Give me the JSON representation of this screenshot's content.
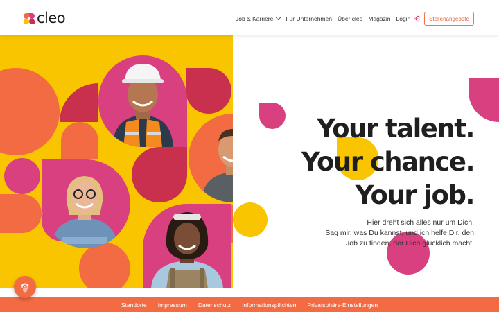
{
  "header": {
    "logo_text": "cleo",
    "nav": [
      {
        "label": "Job & Karriere"
      },
      {
        "label": "Für Unternehmen"
      },
      {
        "label": "Über cleo"
      },
      {
        "label": "Magazin"
      },
      {
        "label": "Login"
      }
    ],
    "cta_label": "Stellenangebote"
  },
  "hero": {
    "headline": [
      "Your talent.",
      "Your chance.",
      "Your job."
    ],
    "subtext": [
      "Hier dreht sich alles nur um Dich.",
      "Sag mir, was Du kannst, und ich helfe Dir, den",
      "Job zu finden, der Dich glücklich macht."
    ]
  },
  "footer": {
    "links": [
      "Standorte",
      "Impressum",
      "Datenschutz",
      "Informationspflichten",
      "Privatsphäre-Einstellungen"
    ]
  },
  "icons": {
    "dropdown": "chevron-down-icon",
    "login": "login-arrow-icon",
    "privacy": "fingerprint-icon"
  },
  "colors": {
    "yellow": "#f8c500",
    "orange": "#f26b43",
    "pink": "#d9407f",
    "crimson": "#c9304e",
    "text": "#1f1f1f"
  }
}
